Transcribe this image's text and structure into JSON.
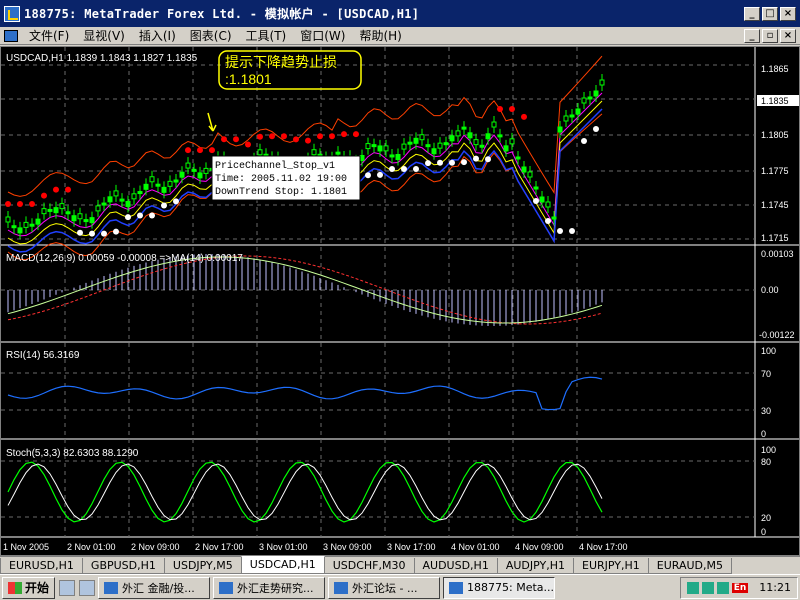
{
  "window": {
    "title": "188775: MetaTrader   Forex Ltd. - 模拟帐户 - [USDCAD,H1]"
  },
  "menu": [
    "文件(F)",
    "显视(V)",
    "插入(I)",
    "图表(C)",
    "工具(T)",
    "窗口(W)",
    "帮助(H)"
  ],
  "chart": {
    "header": "USDCAD,H1  1.1839 1.1843 1.1827 1.1835",
    "price_labels": [
      "1.1865",
      "1.1835",
      "1.1805",
      "1.1775",
      "1.1745",
      "1.1715"
    ],
    "current_price": "1.1835",
    "annotation": "提示下降趋势止损:1.1801",
    "tooltip": [
      "PriceChannel_Stop_v1",
      "Time: 2005.11.02 19:00",
      "DownTrend Stop: 1.1801"
    ],
    "macd_header": "MACD(12,26,9) 0.00059 -0.00008 =>MA(14) 0.00017",
    "macd_labels": [
      "0.00103",
      "0.00",
      "-0.00122"
    ],
    "rsi_header": "RSI(14) 56.3169",
    "rsi_labels": [
      "100",
      "70",
      "30",
      "0"
    ],
    "stoch_header": "Stoch(5,3,3) 82.6303 88.1290",
    "stoch_labels": [
      "100",
      "80",
      "20",
      "0"
    ],
    "time_labels": [
      "1 Nov 2005",
      "2 Nov 01:00",
      "2 Nov 09:00",
      "2 Nov 17:00",
      "3 Nov 01:00",
      "3 Nov 09:00",
      "3 Nov 17:00",
      "4 Nov 01:00",
      "4 Nov 09:00",
      "4 Nov 17:00"
    ],
    "colors": {
      "up_candle": "#00ff00",
      "line_white": "#ffffff",
      "stop_red": "#ff0000",
      "bollinger": "#ff4000",
      "macd_signal": "#ff3030",
      "rsi": "#1e6fff",
      "stoch_main": "#00ff00",
      "stoch_signal": "#ffffff"
    }
  },
  "tabs": [
    "EURUSD,H1",
    "GBPUSD,H1",
    "USDJPY,M5",
    "USDCAD,H1",
    "USDCHF,M30",
    "AUDUSD,H1",
    "AUDJPY,H1",
    "EURJPY,H1",
    "EURAUD,M5"
  ],
  "active_tab": "USDCAD,H1",
  "taskbar": {
    "start": "开始",
    "tasks": [
      "外汇 金融/投...",
      "外汇走势研究...",
      "外汇论坛 - ...",
      "188775: Meta..."
    ],
    "tray_lang": "En",
    "time": "11:21"
  }
}
